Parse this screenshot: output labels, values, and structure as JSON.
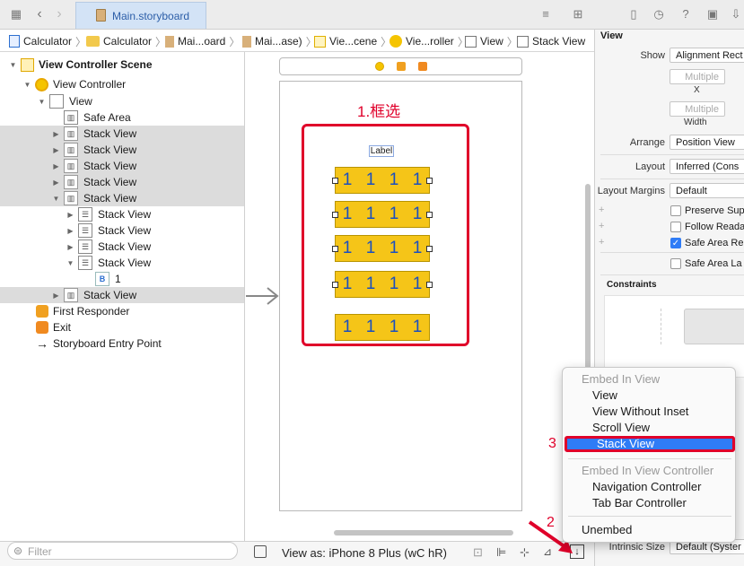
{
  "topbar": {
    "file_tab": "Main.storyboard"
  },
  "breadcrumb": [
    "Calculator",
    "Calculator",
    "Mai...oard",
    "Mai...ase)",
    "Vie...cene",
    "Vie...roller",
    "View",
    "Stack View"
  ],
  "outline": {
    "scene": "View Controller Scene",
    "controller": "View Controller",
    "view": "View",
    "safe_area": "Safe Area",
    "stack_label": "Stack View",
    "label_item": "1",
    "first_responder": "First Responder",
    "exit": "Exit",
    "entry_point": "Storyboard Entry Point",
    "filter_placeholder": "Filter"
  },
  "canvas": {
    "annotation_1": "1.框选",
    "annotation_2": "2",
    "annotation_3": "3",
    "label_text": "Label",
    "cell_value": "1",
    "view_as": "View as: iPhone 8 Plus (wC hR)"
  },
  "inspector": {
    "section": "View",
    "show_label": "Show",
    "show_value": "Alignment Rect",
    "multiple1": "Multiple",
    "x_label": "X",
    "multiple2": "Multiple",
    "width_label": "Width",
    "arrange_label": "Arrange",
    "arrange_value": "Position View",
    "layout_label": "Layout",
    "layout_value": "Inferred (Cons",
    "margins_label": "Layout Margins",
    "margins_value": "Default",
    "preserve": "Preserve Sup",
    "follow": "Follow Reada",
    "safe_area_rel": "Safe Area Re",
    "safe_area_lay": "Safe Area La",
    "constraints": "Constraints",
    "intrinsic_label": "Intrinsic Size",
    "intrinsic_value": "Default (Syster"
  },
  "menu": {
    "embed_in_view": "Embed In View",
    "view": "View",
    "view_without_inset": "View Without Inset",
    "scroll_view": "Scroll View",
    "stack_view": "Stack View",
    "embed_in_vc": "Embed In View Controller",
    "nav_controller": "Navigation Controller",
    "tab_bar_controller": "Tab Bar Controller",
    "unembed": "Unembed"
  },
  "colors": {
    "accent": "#2f7cf6",
    "highlight_red": "#e0002a",
    "stack_yellow": "#f5c518"
  }
}
